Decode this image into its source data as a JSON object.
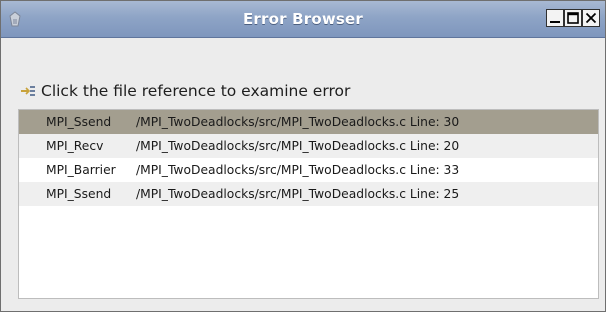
{
  "window": {
    "title": "Error Browser",
    "controls": {
      "minimize": "minimize",
      "maximize": "maximize",
      "close": "close"
    }
  },
  "instruction": {
    "icon": "file-reference-arrow-icon",
    "text": "Click the file reference to examine error"
  },
  "errors": [
    {
      "function": "MPI_Ssend",
      "reference": "/MPI_TwoDeadlocks/src/MPI_TwoDeadlocks.c Line: 30",
      "selected": true
    },
    {
      "function": "MPI_Recv",
      "reference": "/MPI_TwoDeadlocks/src/MPI_TwoDeadlocks.c Line: 20",
      "selected": false
    },
    {
      "function": "MPI_Barrier",
      "reference": "/MPI_TwoDeadlocks/src/MPI_TwoDeadlocks.c Line: 33",
      "selected": false
    },
    {
      "function": "MPI_Ssend",
      "reference": "/MPI_TwoDeadlocks/src/MPI_TwoDeadlocks.c Line: 25",
      "selected": false
    }
  ],
  "colors": {
    "titlebar": "#8ea4c6",
    "selected_row": "#a39e8f",
    "alt_row": "#efefef"
  }
}
